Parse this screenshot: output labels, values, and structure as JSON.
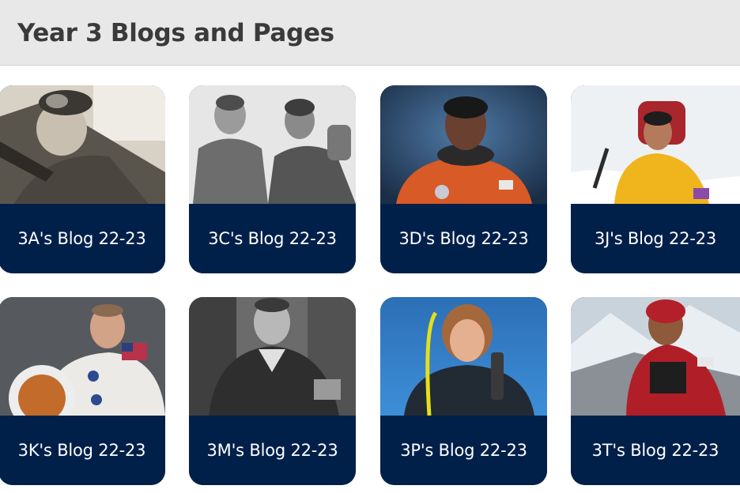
{
  "page": {
    "title": "Year 3 Blogs and Pages"
  },
  "cards": [
    {
      "label": "3A's Blog 22-23"
    },
    {
      "label": "3C's Blog 22-23"
    },
    {
      "label": "3D's Blog 22-23"
    },
    {
      "label": "3J's Blog 22-23"
    },
    {
      "label": "3K's Blog 22-23"
    },
    {
      "label": "3M's Blog 22-23"
    },
    {
      "label": "3P's Blog 22-23"
    },
    {
      "label": "3T's Blog 22-23"
    }
  ],
  "colors": {
    "header_bg": "#e8e8e8",
    "title_text": "#3a3a3a",
    "card_bg": "#00204a",
    "card_text": "#ffffff"
  }
}
